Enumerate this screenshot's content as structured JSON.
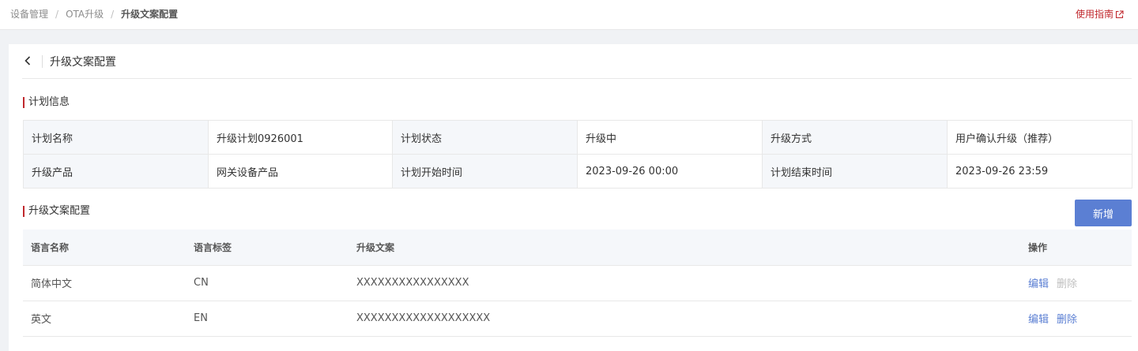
{
  "breadcrumb": [
    "设备管理",
    "OTA升级",
    "升级文案配置"
  ],
  "guide_link": "使用指南",
  "page_title": "升级文案配置",
  "plan_section_title": "计划信息",
  "plan_info": [
    [
      {
        "label": "计划名称",
        "value": "升级计划0926001"
      },
      {
        "label": "计划状态",
        "value": "升级中"
      },
      {
        "label": "升级方式",
        "value": "用户确认升级（推荐）"
      }
    ],
    [
      {
        "label": "升级产品",
        "value": "网关设备产品"
      },
      {
        "label": "计划开始时间",
        "value": "2023-09-26 00:00"
      },
      {
        "label": "计划结束时间",
        "value": "2023-09-26 23:59"
      }
    ]
  ],
  "copy_section_title": "升级文案配置",
  "add_button": "新增",
  "table": {
    "headers": [
      "语言名称",
      "语言标签",
      "升级文案",
      "操作"
    ],
    "rows": [
      {
        "language": "简体中文",
        "tag": "CN",
        "text": "XXXXXXXXXXXXXXXX",
        "edit": "编辑",
        "delete": "删除",
        "delete_disabled": true
      },
      {
        "language": "英文",
        "tag": "EN",
        "text": "XXXXXXXXXXXXXXXXXXX",
        "edit": "编辑",
        "delete": "删除",
        "delete_disabled": false
      }
    ]
  },
  "colors": {
    "accent": "#c0282d",
    "primary": "#5b7fd3",
    "disabled": "#bfbfbf"
  }
}
